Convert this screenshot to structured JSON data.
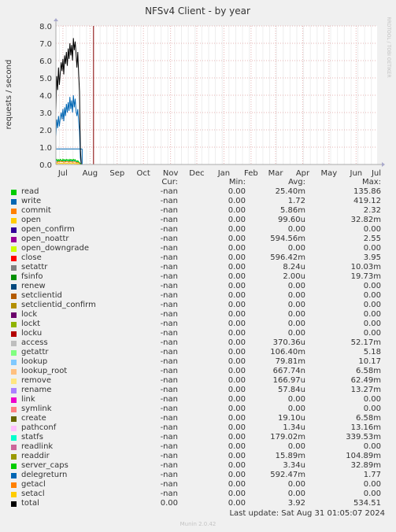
{
  "chart_data": {
    "type": "line",
    "title": "NFSv4 Client - by year",
    "ylabel": "requests / second",
    "watermark": "RRDTOOL / TOBI OETIKER",
    "ylim": [
      0,
      8
    ],
    "yticks": [
      "0.0",
      "1.0",
      "2.0",
      "3.0",
      "4.0",
      "5.0",
      "6.0",
      "7.0",
      "8.0"
    ],
    "xticks": [
      "Jul",
      "Aug",
      "Sep",
      "Oct",
      "Nov",
      "Dec",
      "Jan",
      "Feb",
      "Mar",
      "Apr",
      "May",
      "Jun",
      "Jul"
    ],
    "x_range_days": [
      0,
      367
    ],
    "xtick_days": [
      8,
      39,
      70,
      100,
      131,
      161,
      192,
      223,
      251,
      282,
      312,
      343,
      373
    ],
    "data_end_day": 43,
    "grid": true,
    "colors": {
      "background": "#f0f0f0",
      "plot": "#ffffff",
      "grid_major": "#e4b3b3",
      "grid_minor": "#eeeeee",
      "axis": "#aaaaaa",
      "now_marker": "#880000"
    },
    "series": [
      {
        "name": "total",
        "color": "#000000",
        "x": [
          0,
          1,
          2,
          3,
          4,
          5,
          6,
          7,
          8,
          9,
          10,
          11,
          12,
          13,
          14,
          15,
          16,
          17,
          18,
          19,
          20,
          21,
          22,
          23,
          24,
          25,
          26,
          27,
          28,
          29,
          30,
          31,
          32,
          33,
          34,
          35,
          36,
          37,
          38,
          39,
          40
        ],
        "values": [
          3.0,
          5.1,
          4.3,
          5.6,
          4.6,
          5.3,
          5.9,
          5.4,
          6.1,
          5.2,
          6.3,
          5.8,
          6.5,
          5.7,
          6.7,
          6.1,
          7.0,
          6.3,
          6.9,
          6.0,
          7.3,
          6.6,
          7.1,
          6.4,
          5.6,
          6.5,
          5.2,
          4.2,
          0.9,
          0,
          0,
          0,
          0,
          0,
          0,
          0,
          0,
          0,
          0,
          0,
          0
        ]
      },
      {
        "name": "write",
        "color": "#0066b3",
        "x": [
          0,
          1,
          2,
          3,
          4,
          5,
          6,
          7,
          8,
          9,
          10,
          11,
          12,
          13,
          14,
          15,
          16,
          17,
          18,
          19,
          20,
          21,
          22,
          23,
          24,
          25,
          26,
          27,
          28,
          29,
          30,
          31,
          32,
          33,
          34,
          35,
          36,
          37,
          38,
          39,
          40
        ],
        "values": [
          1.6,
          2.6,
          2.1,
          2.8,
          2.2,
          2.7,
          3.0,
          2.6,
          3.2,
          2.5,
          3.3,
          2.8,
          3.5,
          3.0,
          3.6,
          3.1,
          3.9,
          3.2,
          3.7,
          3.0,
          4.0,
          3.3,
          3.8,
          3.1,
          2.8,
          3.2,
          2.5,
          1.9,
          0.4,
          0,
          0,
          0,
          0,
          0,
          0,
          0,
          0,
          0,
          0,
          0,
          0
        ]
      },
      {
        "name": "close",
        "color": "#00cc00",
        "x": [
          0,
          1,
          2,
          3,
          4,
          5,
          6,
          7,
          8,
          9,
          10,
          11,
          12,
          13,
          14,
          15,
          16,
          17,
          18,
          19,
          20,
          21,
          22,
          23,
          24,
          25,
          26,
          27,
          28,
          29,
          30,
          31,
          32,
          33,
          34,
          35,
          36,
          37,
          38,
          39,
          40
        ],
        "values": [
          0.25,
          0.3,
          0.2,
          0.28,
          0.22,
          0.3,
          0.26,
          0.2,
          0.3,
          0.25,
          0.28,
          0.22,
          0.3,
          0.24,
          0.28,
          0.2,
          0.3,
          0.26,
          0.28,
          0.22,
          0.3,
          0.25,
          0.28,
          0.2,
          0.18,
          0.22,
          0.15,
          0.1,
          0.05,
          0,
          0,
          0,
          0,
          0,
          0,
          0,
          0,
          0,
          0,
          0,
          0
        ]
      },
      {
        "name": "open_noattr",
        "color": "#ff8000",
        "x": [
          0,
          1,
          2,
          3,
          4,
          5,
          6,
          7,
          8,
          9,
          10,
          11,
          12,
          13,
          14,
          15,
          16,
          17,
          18,
          19,
          20,
          21,
          22,
          23,
          24,
          25,
          26,
          27,
          28,
          29,
          30,
          31,
          32,
          33,
          34,
          35,
          36,
          37,
          38,
          39,
          40
        ],
        "values": [
          0.1,
          0.15,
          0.12,
          0.18,
          0.14,
          0.16,
          0.2,
          0.15,
          0.18,
          0.12,
          0.16,
          0.14,
          0.18,
          0.15,
          0.16,
          0.12,
          0.18,
          0.14,
          0.16,
          0.12,
          0.15,
          0.14,
          0.16,
          0.12,
          0.1,
          0.12,
          0.1,
          0.08,
          0.03,
          0,
          0,
          0,
          0,
          0,
          0,
          0,
          0,
          0,
          0,
          0,
          0
        ]
      },
      {
        "name": "lookup_root",
        "color": "#ffcc00",
        "x": [
          0,
          1,
          2,
          3,
          4,
          5,
          6,
          7,
          8,
          9,
          10,
          11,
          12,
          13,
          14,
          15,
          16,
          17,
          18,
          19,
          20,
          21,
          22,
          23,
          24,
          25,
          26,
          27,
          28,
          29,
          30,
          31,
          32,
          33,
          34,
          35,
          36,
          37,
          38,
          39,
          40
        ],
        "values": [
          0.05,
          0.06,
          0.05,
          0.07,
          0.06,
          0.05,
          0.07,
          0.06,
          0.05,
          0.06,
          0.07,
          0.05,
          0.06,
          0.07,
          0.05,
          0.06,
          0.07,
          0.06,
          0.05,
          0.06,
          0.07,
          0.05,
          0.06,
          0.05,
          0.04,
          0.05,
          0.04,
          0.03,
          0.02,
          0,
          0,
          0,
          0,
          0,
          0,
          0,
          0,
          0,
          0,
          0,
          0
        ]
      },
      {
        "name": "delegreturn",
        "color": "#00aaaa",
        "x": [
          0,
          1,
          2,
          3,
          4,
          5,
          6,
          7,
          8,
          9,
          10,
          11,
          12,
          13,
          14,
          15,
          16,
          17,
          18,
          19,
          20,
          21,
          22,
          23,
          24,
          25,
          26,
          27,
          28,
          29,
          30,
          31,
          32,
          33,
          34,
          35,
          36,
          37,
          38,
          39,
          40
        ],
        "values": [
          0.2,
          0.24,
          0.18,
          0.26,
          0.2,
          0.24,
          0.22,
          0.18,
          0.26,
          0.2,
          0.24,
          0.18,
          0.26,
          0.22,
          0.24,
          0.18,
          0.26,
          0.2,
          0.24,
          0.18,
          0.25,
          0.2,
          0.24,
          0.18,
          0.15,
          0.18,
          0.12,
          0.09,
          0.04,
          0,
          0,
          0,
          0,
          0,
          0,
          0,
          0,
          0,
          0,
          0,
          0
        ]
      }
    ],
    "band": {
      "name": "write-max-band",
      "color": "#0066b3",
      "value": 0.9,
      "x_from": 0,
      "x_to": 30
    }
  },
  "legend": {
    "headers": {
      "cur": "Cur:",
      "min": "Min:",
      "avg": "Avg:",
      "max": "Max:"
    },
    "rows": [
      {
        "name": "read",
        "color": "#00cc00",
        "cur": "-nan",
        "min": "0.00",
        "avg": "25.40m",
        "max": "135.86"
      },
      {
        "name": "write",
        "color": "#0066b3",
        "cur": "-nan",
        "min": "0.00",
        "avg": "1.72",
        "max": "419.12"
      },
      {
        "name": "commit",
        "color": "#ff8000",
        "cur": "-nan",
        "min": "0.00",
        "avg": "5.86m",
        "max": "2.32"
      },
      {
        "name": "open",
        "color": "#ffcc00",
        "cur": "-nan",
        "min": "0.00",
        "avg": "99.60u",
        "max": "32.82m"
      },
      {
        "name": "open_confirm",
        "color": "#330099",
        "cur": "-nan",
        "min": "0.00",
        "avg": "0.00",
        "max": "0.00"
      },
      {
        "name": "open_noattr",
        "color": "#990099",
        "cur": "-nan",
        "min": "0.00",
        "avg": "594.56m",
        "max": "2.55"
      },
      {
        "name": "open_downgrade",
        "color": "#ccff00",
        "cur": "-nan",
        "min": "0.00",
        "avg": "0.00",
        "max": "0.00"
      },
      {
        "name": "close",
        "color": "#ff0000",
        "cur": "-nan",
        "min": "0.00",
        "avg": "596.42m",
        "max": "3.95"
      },
      {
        "name": "setattr",
        "color": "#808080",
        "cur": "-nan",
        "min": "0.00",
        "avg": "8.24u",
        "max": "10.03m"
      },
      {
        "name": "fsinfo",
        "color": "#008f00",
        "cur": "-nan",
        "min": "0.00",
        "avg": "2.00u",
        "max": "19.73m"
      },
      {
        "name": "renew",
        "color": "#00487d",
        "cur": "-nan",
        "min": "0.00",
        "avg": "0.00",
        "max": "0.00"
      },
      {
        "name": "setclientid",
        "color": "#b35a00",
        "cur": "-nan",
        "min": "0.00",
        "avg": "0.00",
        "max": "0.00"
      },
      {
        "name": "setclientid_confirm",
        "color": "#b38f00",
        "cur": "-nan",
        "min": "0.00",
        "avg": "0.00",
        "max": "0.00"
      },
      {
        "name": "lock",
        "color": "#6b006b",
        "cur": "-nan",
        "min": "0.00",
        "avg": "0.00",
        "max": "0.00"
      },
      {
        "name": "lockt",
        "color": "#8fb300",
        "cur": "-nan",
        "min": "0.00",
        "avg": "0.00",
        "max": "0.00"
      },
      {
        "name": "locku",
        "color": "#b30000",
        "cur": "-nan",
        "min": "0.00",
        "avg": "0.00",
        "max": "0.00"
      },
      {
        "name": "access",
        "color": "#bebebe",
        "cur": "-nan",
        "min": "0.00",
        "avg": "370.36u",
        "max": "52.17m"
      },
      {
        "name": "getattr",
        "color": "#80ff80",
        "cur": "-nan",
        "min": "0.00",
        "avg": "106.40m",
        "max": "5.18"
      },
      {
        "name": "lookup",
        "color": "#80c9ff",
        "cur": "-nan",
        "min": "0.00",
        "avg": "79.81m",
        "max": "10.17"
      },
      {
        "name": "lookup_root",
        "color": "#ffc080",
        "cur": "-nan",
        "min": "0.00",
        "avg": "667.74n",
        "max": "6.58m"
      },
      {
        "name": "remove",
        "color": "#ffe680",
        "cur": "-nan",
        "min": "0.00",
        "avg": "166.97u",
        "max": "62.49m"
      },
      {
        "name": "rename",
        "color": "#aa80ff",
        "cur": "-nan",
        "min": "0.00",
        "avg": "57.84u",
        "max": "13.27m"
      },
      {
        "name": "link",
        "color": "#ee00cc",
        "cur": "-nan",
        "min": "0.00",
        "avg": "0.00",
        "max": "0.00"
      },
      {
        "name": "symlink",
        "color": "#ff8080",
        "cur": "-nan",
        "min": "0.00",
        "avg": "0.00",
        "max": "0.00"
      },
      {
        "name": "create",
        "color": "#666600",
        "cur": "-nan",
        "min": "0.00",
        "avg": "19.10u",
        "max": "6.58m"
      },
      {
        "name": "pathconf",
        "color": "#ffbfff",
        "cur": "-nan",
        "min": "0.00",
        "avg": "1.34u",
        "max": "13.16m"
      },
      {
        "name": "statfs",
        "color": "#00ffcc",
        "cur": "-nan",
        "min": "0.00",
        "avg": "179.02m",
        "max": "339.53m"
      },
      {
        "name": "readlink",
        "color": "#cc6699",
        "cur": "-nan",
        "min": "0.00",
        "avg": "0.00",
        "max": "0.00"
      },
      {
        "name": "readdir",
        "color": "#999900",
        "cur": "-nan",
        "min": "0.00",
        "avg": "15.89m",
        "max": "104.89m"
      },
      {
        "name": "server_caps",
        "color": "#00cc00",
        "cur": "-nan",
        "min": "0.00",
        "avg": "3.34u",
        "max": "32.89m"
      },
      {
        "name": "delegreturn",
        "color": "#0066b3",
        "cur": "-nan",
        "min": "0.00",
        "avg": "592.47m",
        "max": "1.77"
      },
      {
        "name": "getacl",
        "color": "#ff8000",
        "cur": "-nan",
        "min": "0.00",
        "avg": "0.00",
        "max": "0.00"
      },
      {
        "name": "setacl",
        "color": "#ffcc00",
        "cur": "-nan",
        "min": "0.00",
        "avg": "0.00",
        "max": "0.00"
      },
      {
        "name": "total",
        "color": "#000000",
        "cur": "0.00",
        "min": "0.00",
        "avg": "3.92",
        "max": "534.51"
      }
    ]
  },
  "footer": {
    "last_update": "Last update: Sat Aug 31 01:05:07 2024",
    "generator": "Munin 2.0.42"
  }
}
